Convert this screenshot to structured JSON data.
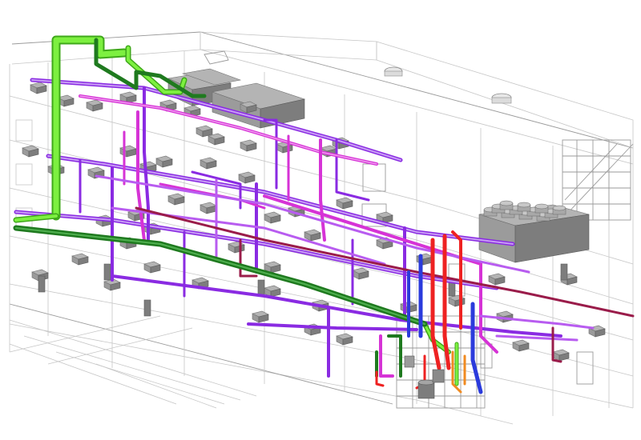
{
  "colors": {
    "background": "#ffffff",
    "building_wireframe": "#c6c6c6",
    "equipment_gray": "#9b9b9b",
    "duct_light_green": "#66e02a",
    "pipe_dark_green": "#1f7a1f",
    "pipe_purple": "#8a2be2",
    "pipe_violet": "#b85cf0",
    "pipe_magenta": "#d633d6",
    "pipe_maroon": "#9a1c4a",
    "pipe_red": "#ee2222",
    "pipe_blue": "#2b3bdc",
    "pipe_orange": "#f08a20"
  },
  "icons": [
    "rooftop-unit-icon",
    "exhaust-fan-icon",
    "cooling-tower-icon",
    "pump-icon"
  ]
}
